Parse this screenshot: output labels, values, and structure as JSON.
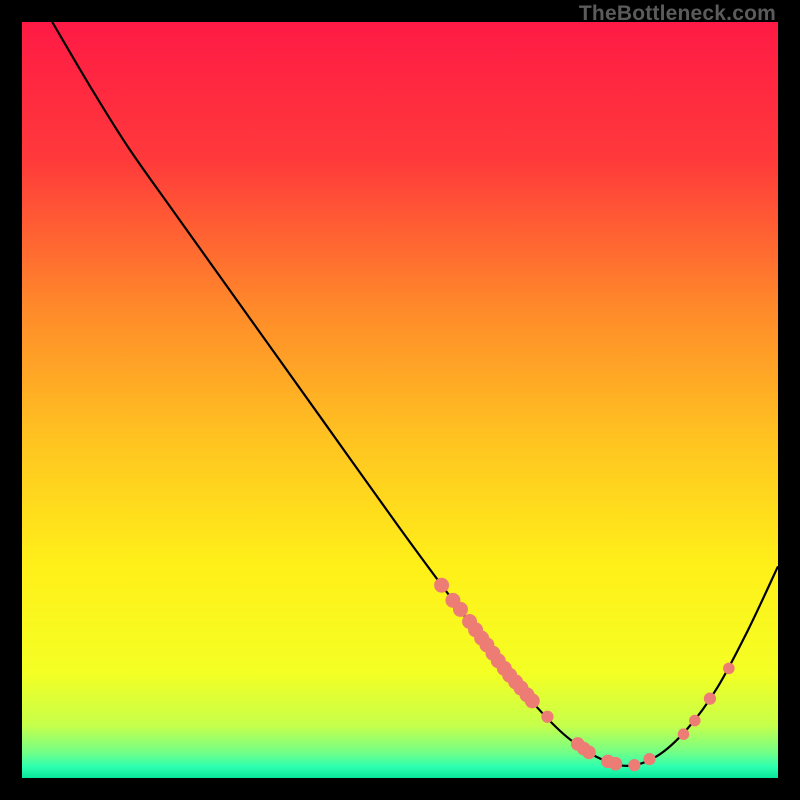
{
  "watermark": "TheBottleneck.com",
  "chart_data": {
    "type": "line",
    "title": "",
    "xlabel": "",
    "ylabel": "",
    "xlim": [
      0,
      100
    ],
    "ylim": [
      0,
      100
    ],
    "gradient_stops": [
      {
        "offset": 0.0,
        "color": "#ff1a45"
      },
      {
        "offset": 0.18,
        "color": "#ff393b"
      },
      {
        "offset": 0.38,
        "color": "#ff8a2a"
      },
      {
        "offset": 0.55,
        "color": "#ffc321"
      },
      {
        "offset": 0.72,
        "color": "#fff019"
      },
      {
        "offset": 0.86,
        "color": "#f4ff23"
      },
      {
        "offset": 0.93,
        "color": "#c7ff4a"
      },
      {
        "offset": 0.965,
        "color": "#76ff85"
      },
      {
        "offset": 0.985,
        "color": "#2effb0"
      },
      {
        "offset": 1.0,
        "color": "#08e69a"
      }
    ],
    "curve": [
      {
        "x": 4.0,
        "y": 100.0
      },
      {
        "x": 9.0,
        "y": 91.5
      },
      {
        "x": 14.0,
        "y": 83.5
      },
      {
        "x": 20.0,
        "y": 75.0
      },
      {
        "x": 30.0,
        "y": 61.0
      },
      {
        "x": 40.0,
        "y": 47.0
      },
      {
        "x": 50.0,
        "y": 33.0
      },
      {
        "x": 57.0,
        "y": 23.5
      },
      {
        "x": 63.0,
        "y": 15.5
      },
      {
        "x": 68.0,
        "y": 9.5
      },
      {
        "x": 72.0,
        "y": 5.5
      },
      {
        "x": 76.0,
        "y": 2.8
      },
      {
        "x": 80.0,
        "y": 1.6
      },
      {
        "x": 84.0,
        "y": 2.9
      },
      {
        "x": 88.0,
        "y": 6.5
      },
      {
        "x": 92.0,
        "y": 12.0
      },
      {
        "x": 96.0,
        "y": 19.5
      },
      {
        "x": 100.0,
        "y": 28.0
      }
    ],
    "markers": [
      {
        "x": 55.5,
        "y": 25.5,
        "r": 1.1
      },
      {
        "x": 57.0,
        "y": 23.5,
        "r": 1.1
      },
      {
        "x": 58.0,
        "y": 22.3,
        "r": 1.1
      },
      {
        "x": 59.2,
        "y": 20.7,
        "r": 1.1
      },
      {
        "x": 60.0,
        "y": 19.6,
        "r": 1.1
      },
      {
        "x": 60.8,
        "y": 18.5,
        "r": 1.1
      },
      {
        "x": 61.5,
        "y": 17.6,
        "r": 1.1
      },
      {
        "x": 62.3,
        "y": 16.5,
        "r": 1.1
      },
      {
        "x": 63.0,
        "y": 15.5,
        "r": 1.1
      },
      {
        "x": 63.8,
        "y": 14.5,
        "r": 1.1
      },
      {
        "x": 64.5,
        "y": 13.6,
        "r": 1.1
      },
      {
        "x": 65.3,
        "y": 12.7,
        "r": 1.1
      },
      {
        "x": 66.0,
        "y": 11.9,
        "r": 1.1
      },
      {
        "x": 66.8,
        "y": 11.0,
        "r": 1.1
      },
      {
        "x": 67.5,
        "y": 10.2,
        "r": 1.1
      },
      {
        "x": 69.5,
        "y": 8.1,
        "r": 0.9
      },
      {
        "x": 73.5,
        "y": 4.5,
        "r": 1.0
      },
      {
        "x": 74.3,
        "y": 3.9,
        "r": 1.0
      },
      {
        "x": 75.0,
        "y": 3.4,
        "r": 1.0
      },
      {
        "x": 77.5,
        "y": 2.2,
        "r": 1.0
      },
      {
        "x": 78.5,
        "y": 1.9,
        "r": 1.0
      },
      {
        "x": 81.0,
        "y": 1.7,
        "r": 0.9
      },
      {
        "x": 83.0,
        "y": 2.5,
        "r": 0.9
      },
      {
        "x": 87.5,
        "y": 5.8,
        "r": 0.85
      },
      {
        "x": 89.0,
        "y": 7.6,
        "r": 0.85
      },
      {
        "x": 91.0,
        "y": 10.5,
        "r": 0.9
      },
      {
        "x": 93.5,
        "y": 14.5,
        "r": 0.85
      }
    ],
    "marker_color": "#ed7c74",
    "curve_color": "#000000"
  }
}
